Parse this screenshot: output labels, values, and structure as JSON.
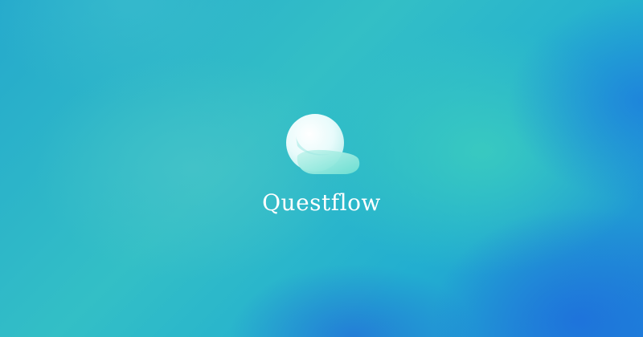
{
  "brand": {
    "name": "Questflow",
    "logo_icon": "speech-bubble-q-icon",
    "text_color": "#ffffff"
  },
  "colors": {
    "background_teal": "#33bfc6",
    "background_blue": "#1f86d8"
  }
}
